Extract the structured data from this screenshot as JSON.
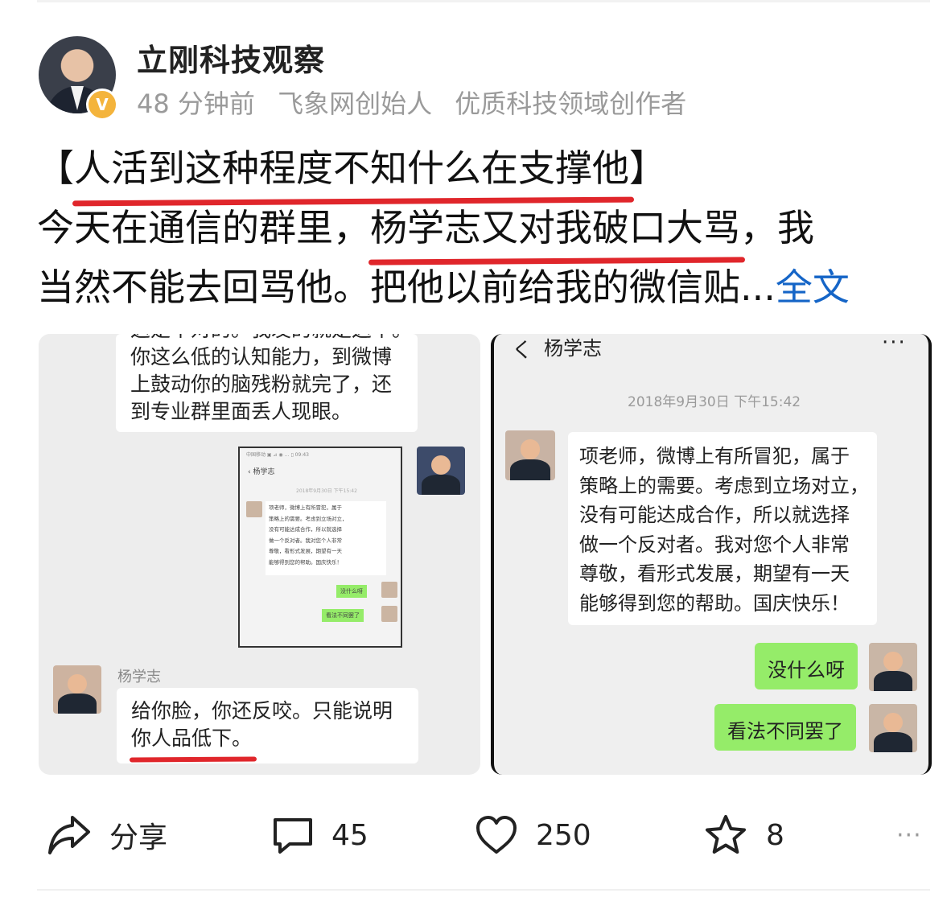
{
  "post": {
    "author": "立刚科技观察",
    "verified_badge": "V",
    "meta": [
      "48 分钟前",
      "飞象网创始人",
      "优质科技领域创作者"
    ],
    "title": "【人活到这种程度不知什么在支撑他】",
    "title_highlight": "人活到这种程度不知什么在支撑他",
    "line2_a": "今天在通信的群里，",
    "line2_highlight": "杨学志又对我破口大骂",
    "line2_b": "，我",
    "line3": "当然不能去回骂他。把他以前给我的微信贴...",
    "more_label": "全文",
    "accent_color": "#1565c7",
    "underline_color": "#e0262b"
  },
  "image1": {
    "cut_text": "这是个对的。我发的就是这个。",
    "bubble_top": [
      "你这么低的认知能力，到微博",
      "上鼓动你的脑残粉就完了，还",
      "到专业群里面丢人现眼。"
    ],
    "mini": {
      "status": "中国移动 ▣ ⊿ ◉ … ▯ 09:43",
      "name": "杨学志",
      "date": "2018年9月30日 下午15:42",
      "msg": [
        "项老师，微博上有所冒犯，属于",
        "策略上的需要。考虑到立场对立，",
        "没有可能达成合作，所以就选择",
        "做一个反对者。我对您个人非常",
        "尊敬，看形式发展，期望有一天",
        "能够得到您的帮助。国庆快乐！"
      ],
      "reply1": "没什么呀",
      "reply2": "看法不同罢了"
    },
    "sender": "杨学志",
    "bubble_bottom_1": "给你脸，你还反咬。只能说明",
    "bubble_bottom_2": "你人品低下。"
  },
  "image2": {
    "back": "く",
    "title": "杨学志",
    "more": "···",
    "date": "2018年9月30日 下午15:42",
    "msg": [
      "项老师，微博上有所冒犯，属于",
      "策略上的需要。考虑到立场对立，",
      "没有可能达成合作，所以就选择",
      "做一个反对者。我对您个人非常",
      "尊敬，看形式发展，期望有一天",
      "能够得到您的帮助。国庆快乐！"
    ],
    "reply1": "没什么呀",
    "reply2": "看法不同罢了",
    "bubble_green": "#95ec69"
  },
  "actions": {
    "share_label": "分享",
    "comments": "45",
    "likes": "250",
    "favorites": "8",
    "more": "···"
  }
}
